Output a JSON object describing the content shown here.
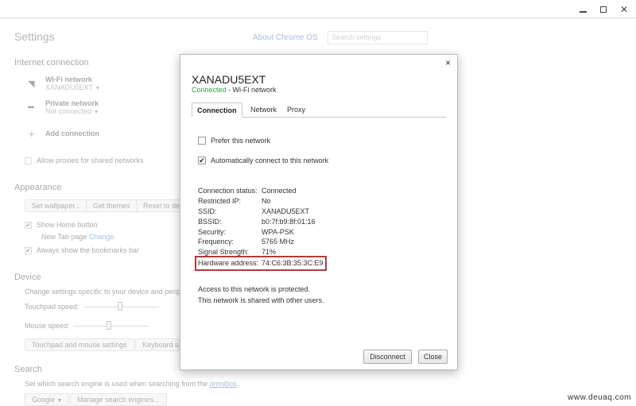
{
  "settings": {
    "title": "Settings",
    "about_link": "About Chrome OS",
    "search_placeholder": "Search settings",
    "internet": {
      "heading": "Internet connection",
      "wifi_label": "Wi-Fi network",
      "wifi_value": "XANADU5EXT",
      "private_label": "Private network",
      "private_value": "Not connected",
      "add_connection": "Add connection",
      "allow_proxies": "Allow proxies for shared networks"
    },
    "appearance": {
      "heading": "Appearance",
      "set_wallpaper": "Set wallpaper...",
      "get_themes": "Get themes",
      "reset": "Reset to de",
      "show_home": "Show Home button",
      "new_tab": "New Tab page",
      "change": "Change",
      "always_bookmarks": "Always show the bookmarks bar"
    },
    "device": {
      "heading": "Device",
      "desc": "Change settings specific to your device and perip",
      "touchpad_speed": "Touchpad speed:",
      "mouse_speed": "Mouse speed:",
      "touchpad_btn": "Touchpad and mouse settings",
      "keyboard_btn": "Keyboard se"
    },
    "search": {
      "heading": "Search",
      "desc": "Set which search engine is used when searching from the",
      "omnibox": "omnibox",
      "engine": "Google",
      "manage": "Manage search engines..."
    }
  },
  "dialog": {
    "close_glyph": "×",
    "network_name": "XANADU5EXT",
    "status_connected": "Connected",
    "status_type": " - Wi-Fi network",
    "tabs": [
      "Connection",
      "Network",
      "Proxy"
    ],
    "prefer_label": "Prefer this network",
    "prefer_checked": false,
    "auto_label": "Automatically connect to this network",
    "auto_checked": true,
    "info": [
      {
        "key": "Connection status:",
        "value": "Connected"
      },
      {
        "key": "Restricted IP:",
        "value": "No"
      },
      {
        "key": "SSID:",
        "value": "XANADU5EXT"
      },
      {
        "key": "BSSID:",
        "value": "b0:7f:b9:8f:01:16"
      },
      {
        "key": "Security:",
        "value": "WPA-PSK"
      },
      {
        "key": "Frequency:",
        "value": "5765 MHz"
      },
      {
        "key": "Signal Strength:",
        "value": "71%"
      },
      {
        "key": "Hardware address:",
        "value": "74:C6:3B:35:3C:E9"
      }
    ],
    "note_protected": "Access to this network is protected.",
    "note_shared": "This network is shared with other users.",
    "disconnect": "Disconnect",
    "close": "Close"
  },
  "watermark": "www.deuaq.com",
  "colors": {
    "connected": "#3a9c4a",
    "link": "#2d5db6",
    "highlight_box": "#b43a3a"
  }
}
